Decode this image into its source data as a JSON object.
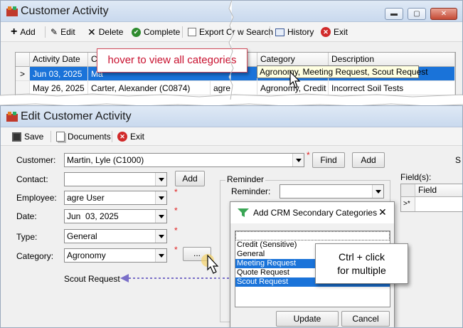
{
  "top_window": {
    "title": "Customer Activity",
    "toolbar": {
      "add": "Add",
      "edit": "Edit",
      "delete": "Delete",
      "complete": "Complete",
      "export": "Export Cr",
      "view_search": "w Search",
      "history": "History",
      "exit": "Exit"
    },
    "grid": {
      "columns": [
        "Activity Date",
        "C",
        "Category",
        "Description"
      ],
      "rows": [
        {
          "marker": ">",
          "date": "Jun 03, 2025",
          "customer": "Ma",
          "category": "Agronomy, Meeting Request, Scout Request",
          "description": "",
          "selected": true
        },
        {
          "marker": "",
          "date": "May 26, 2025",
          "customer": "Carter, Alexander (C0874)",
          "employee": "agre",
          "category": "Agronomy, Credit (S",
          "description": "Incorrect Soil Tests",
          "selected": false
        }
      ]
    },
    "hover_callout": "hover to view all categories",
    "tooltip": "Agronomy, Meeting Request, Scout Request"
  },
  "bottom_window": {
    "title": "Edit Customer Activity",
    "toolbar": {
      "save": "Save",
      "documents": "Documents",
      "exit": "Exit"
    },
    "form": {
      "customer_label": "Customer:",
      "customer_value": "Martin, Lyle (C1000)",
      "find_button": "Find",
      "add_button": "Add",
      "contact_label": "Contact:",
      "contact_value": "",
      "contact_add_button": "Add",
      "employee_label": "Employee:",
      "employee_value": "agre User",
      "date_label": "Date:",
      "date_value": "Jun  03, 2025",
      "type_label": "Type:",
      "type_value": "General",
      "category_label": "Category:",
      "category_value": "Agronomy",
      "secondary_display": "Scout Request",
      "more_button": "...",
      "reminder_group": "Reminder",
      "reminder_label": "Reminder:",
      "reminder_value": "",
      "fields_label": "Field(s):",
      "fields_column": "Field",
      "fields_new_row_marker": ">*",
      "right_edge_letter": "S"
    },
    "dialog": {
      "title": "Add CRM Secondary Categories",
      "close": "✕",
      "items": [
        {
          "label": "",
          "selected": false
        },
        {
          "label": "Credit (Sensitive)",
          "selected": false
        },
        {
          "label": "General",
          "selected": false
        },
        {
          "label": "Meeting Request",
          "selected": true
        },
        {
          "label": "Quote Request",
          "selected": false
        },
        {
          "label": "Scout Request",
          "selected": true
        }
      ],
      "update_button": "Update",
      "cancel_button": "Cancel"
    },
    "ctrl_callout_line1": "Ctrl + click",
    "ctrl_callout_line2": "for multiple"
  }
}
